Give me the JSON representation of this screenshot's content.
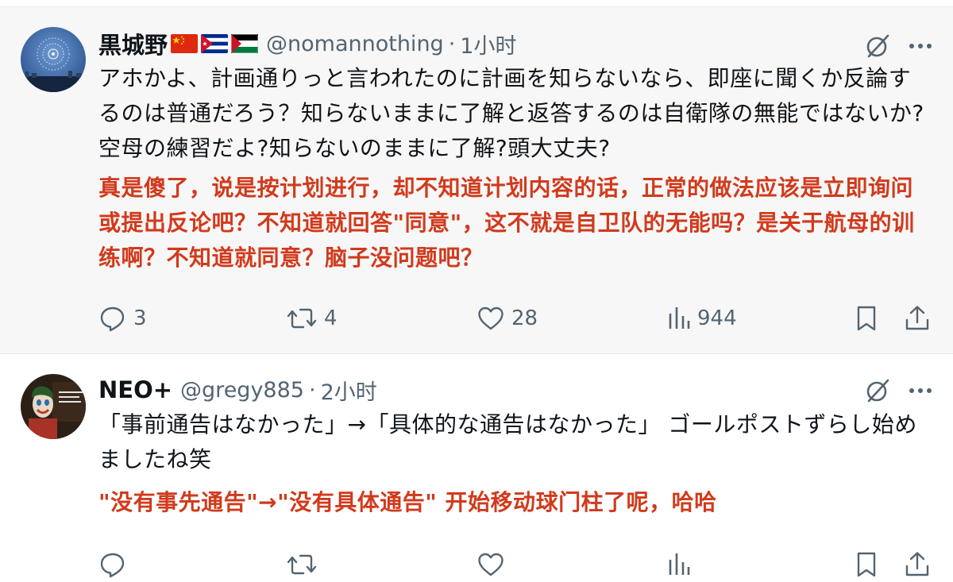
{
  "tweets": [
    {
      "display_name": "黒城野",
      "flags": [
        "china-flag",
        "cuba-flag",
        "palestine-flag"
      ],
      "handle": "@nomannothing",
      "separator": "·",
      "time": "1小时",
      "text_jp": "アホかよ、計画通りっと言われたのに計画を知らないなら、即座に聞くか反論するのは普通だろう？知らないままに了解と返答するのは自衛隊の無能ではないか?空母の練習だよ?知らないのままに了解?頭大丈夫?",
      "text_zh": "真是傻了，说是按计划进行，却不知道计划内容的话，正常的做法应该是立即询问或提出反论吧？不知道就回答\"同意\"，这不就是自卫队的无能吗？是关于航母的训练啊？不知道就同意？脑子没问题吧？",
      "counts": {
        "replies": "3",
        "reposts": "4",
        "likes": "28",
        "views": "944"
      }
    },
    {
      "display_name": "NEO+",
      "handle": "@gregy885",
      "separator": "·",
      "time": "2小时",
      "text_jp": "「事前通告はなかった」→「具体的な通告はなかった」 ゴールポストずらし始めましたね笑",
      "text_zh": "\"没有事先通告\"→\"没有具体通告\" 开始移动球门柱了呢，哈哈",
      "counts": {
        "replies": "",
        "reposts": "",
        "likes": "",
        "views": ""
      }
    }
  ],
  "icons": {
    "grok": "grok-icon",
    "more": "more-icon",
    "reply": "reply-icon",
    "repost": "repost-icon",
    "like": "like-icon",
    "views": "views-icon",
    "bookmark": "bookmark-icon",
    "share": "share-icon"
  },
  "colors": {
    "muted": "#536471",
    "text": "#0f1419",
    "translation": "#d13a1c",
    "highlight_bg": "#f7f7f7"
  }
}
